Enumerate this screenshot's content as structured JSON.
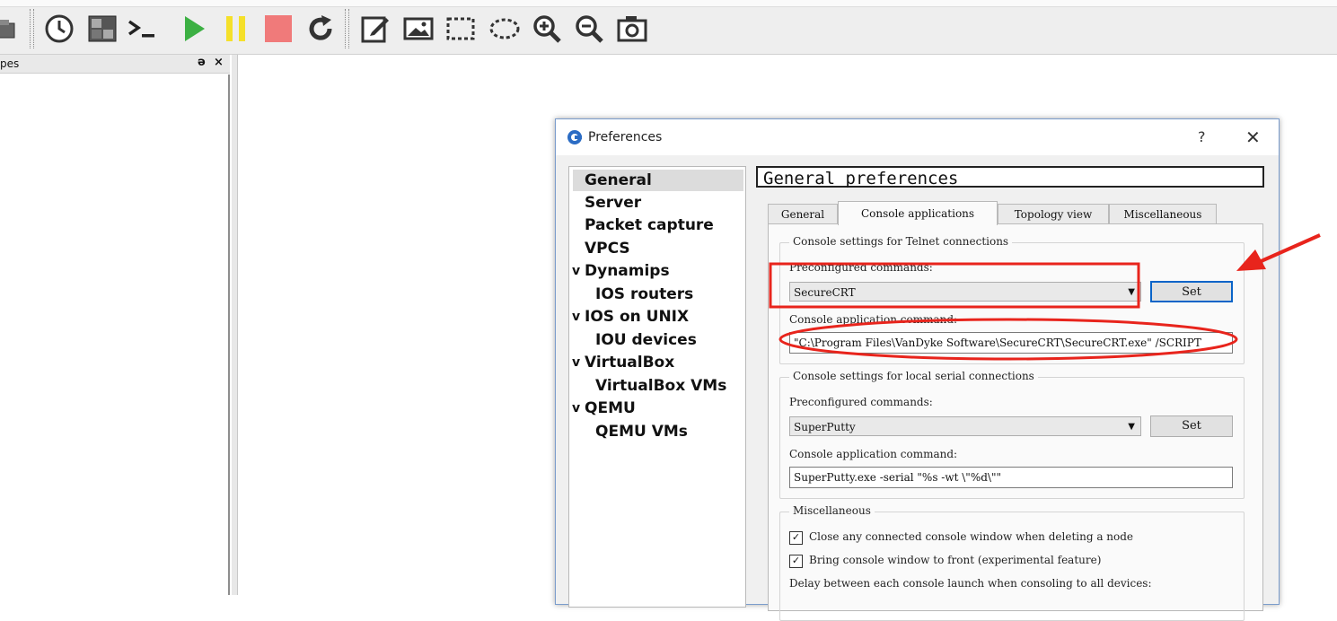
{
  "dock": {
    "title": "pes",
    "float_glyph": "ə",
    "close_glyph": "×"
  },
  "dialog": {
    "title": "Preferences",
    "help": "?",
    "close": "✕"
  },
  "nav": {
    "items": [
      {
        "label": "General",
        "indent": 0,
        "chevron": ""
      },
      {
        "label": "Server",
        "indent": 0,
        "chevron": ""
      },
      {
        "label": "Packet capture",
        "indent": 0,
        "chevron": ""
      },
      {
        "label": "VPCS",
        "indent": 0,
        "chevron": ""
      },
      {
        "label": "Dynamips",
        "indent": 0,
        "chevron": "v"
      },
      {
        "label": "IOS routers",
        "indent": 1,
        "chevron": ""
      },
      {
        "label": "IOS on UNIX",
        "indent": 0,
        "chevron": "v"
      },
      {
        "label": "IOU devices",
        "indent": 1,
        "chevron": ""
      },
      {
        "label": "VirtualBox",
        "indent": 0,
        "chevron": "v"
      },
      {
        "label": "VirtualBox VMs",
        "indent": 1,
        "chevron": ""
      },
      {
        "label": "QEMU",
        "indent": 0,
        "chevron": "v"
      },
      {
        "label": "QEMU VMs",
        "indent": 1,
        "chevron": ""
      }
    ]
  },
  "pane": {
    "title": "General preferences",
    "tabs": [
      "General",
      "Console applications",
      "Topology view",
      "Miscellaneous"
    ]
  },
  "telnet": {
    "group_title": "Console settings for Telnet connections",
    "preconfigured_label": "Preconfigured commands:",
    "preconfigured_value": "SecureCRT",
    "set_label": "Set",
    "command_label": "Console application command:",
    "command_value": "\"C:\\Program Files\\VanDyke Software\\SecureCRT\\SecureCRT.exe\" /SCRIPT"
  },
  "serial": {
    "group_title": "Console settings for local serial connections",
    "preconfigured_label": "Preconfigured commands:",
    "preconfigured_value": "SuperPutty",
    "set_label": "Set",
    "command_label": "Console application command:",
    "command_value": "SuperPutty.exe -serial \"%s -wt \\\"%d\\\"\""
  },
  "misc": {
    "group_title": "Miscellaneous",
    "check1": "Close any connected console window when deleting a node",
    "check2": "Bring console window to front (experimental feature)",
    "delay_label": "Delay between each console launch when consoling to all devices:",
    "check_mark": "✓"
  },
  "colors": {
    "play": "#3cb043",
    "pause": "#f5e02a",
    "stop": "#f07a7a",
    "annotation": "#e8241c"
  },
  "toolbar_icons": [
    "snapshot-icon",
    "clock-icon",
    "device-icon",
    "console-icon",
    "play-icon",
    "pause-icon",
    "stop-icon",
    "reload-icon",
    "note-icon",
    "image-icon",
    "rectangle-icon",
    "ellipse-icon",
    "zoom-in-icon",
    "zoom-out-icon",
    "camera-icon"
  ]
}
